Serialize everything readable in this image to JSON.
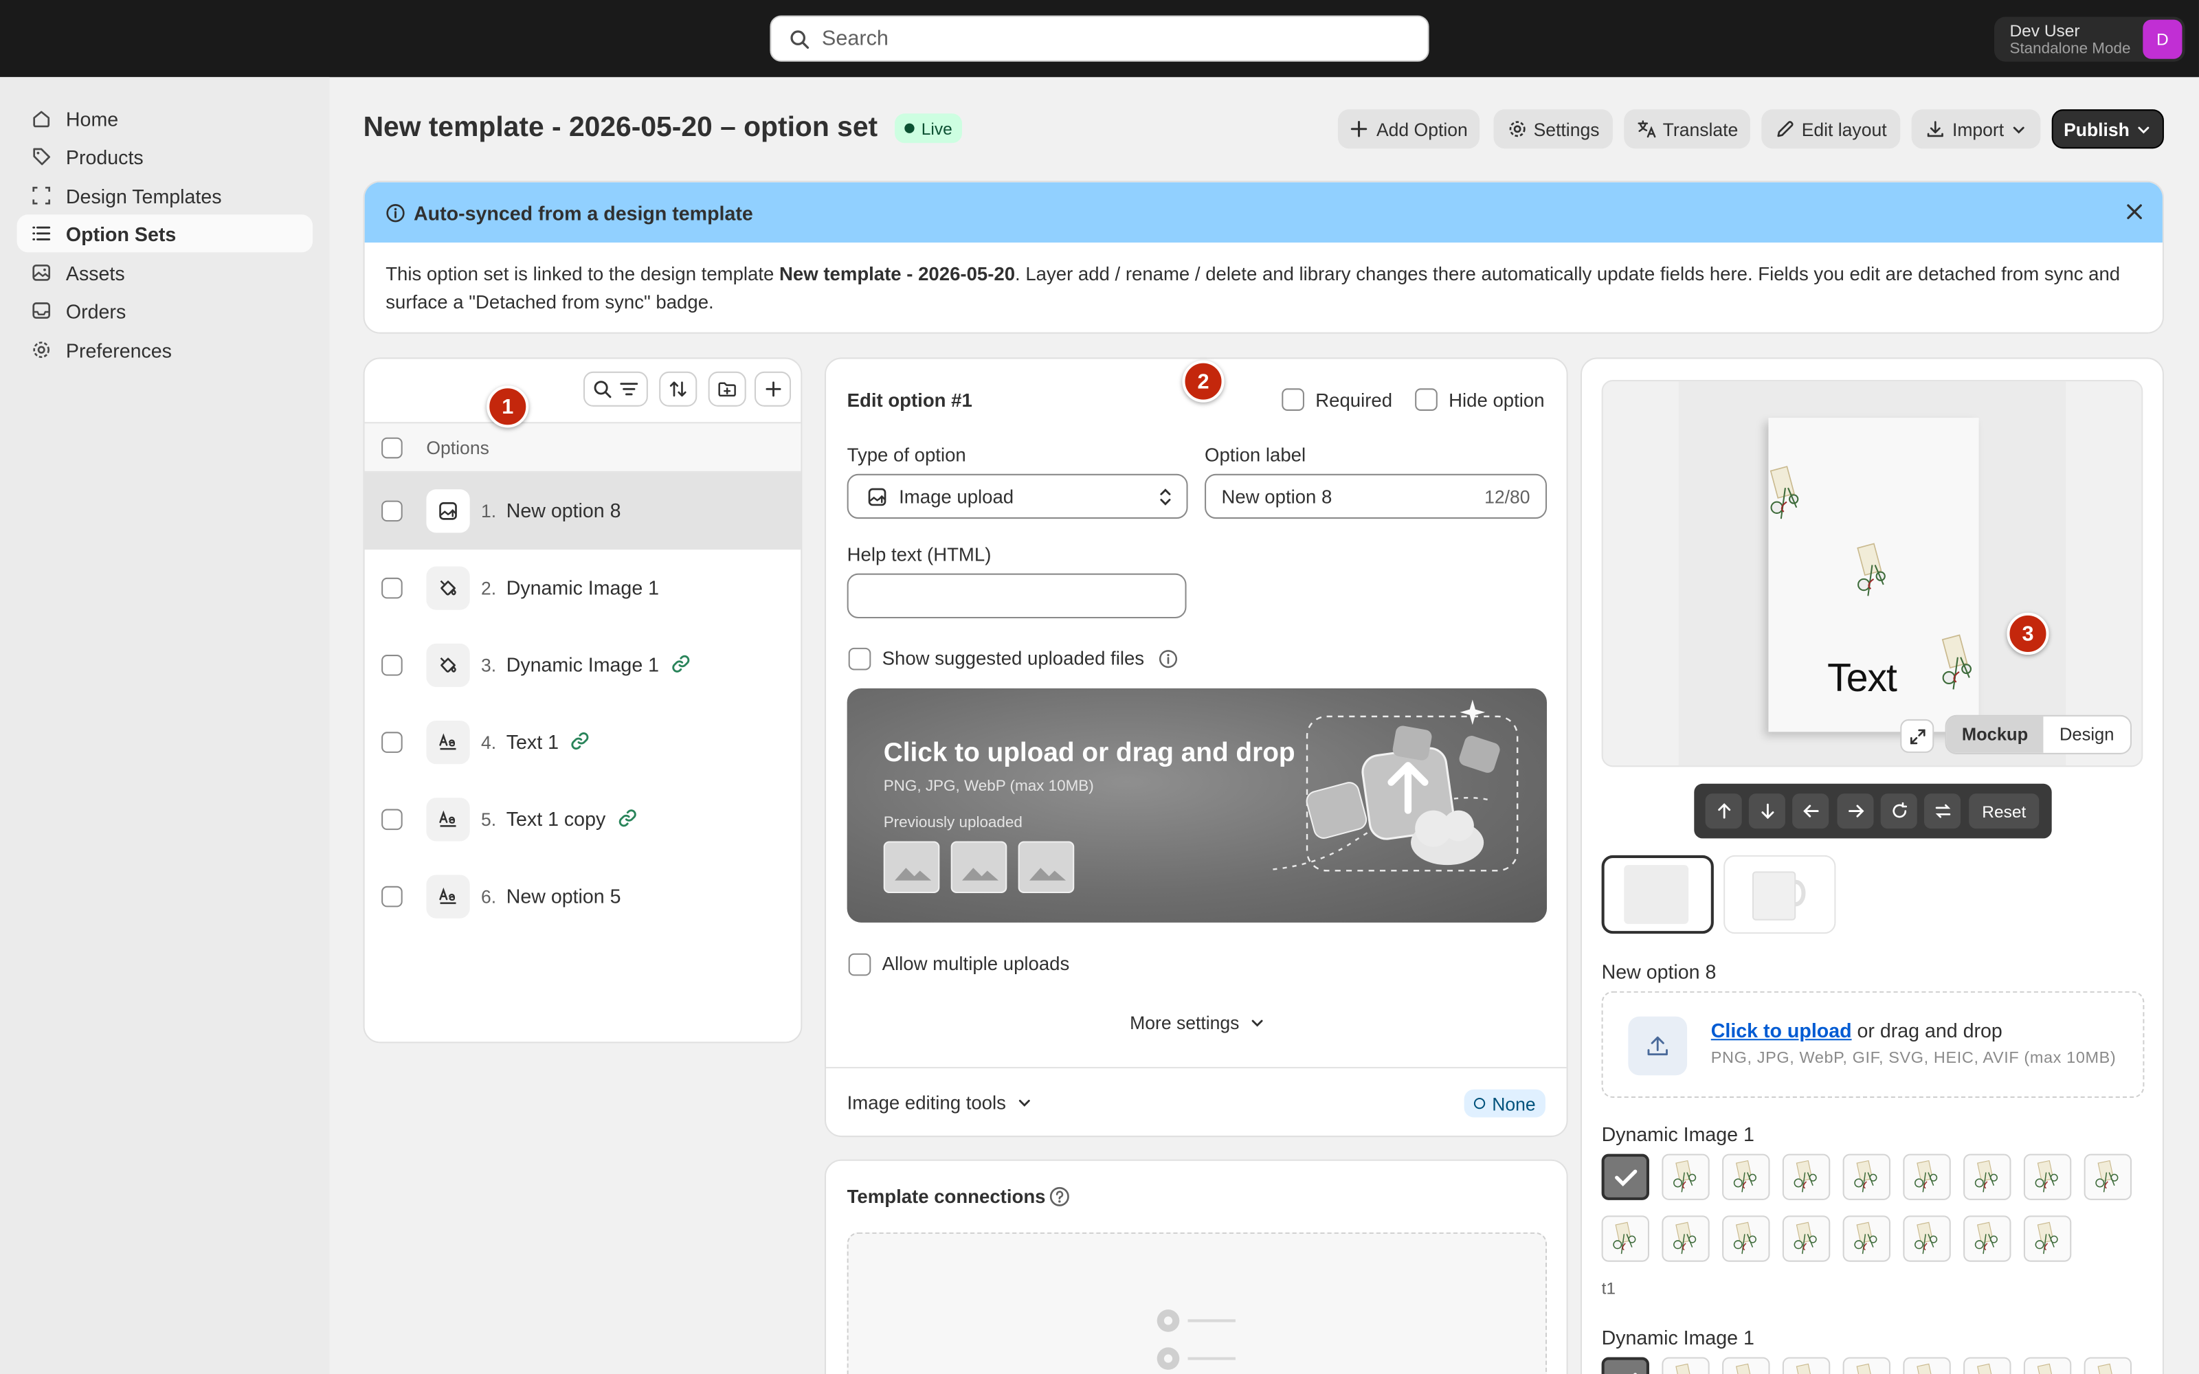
{
  "topbar": {
    "search_placeholder": "Search",
    "user_name": "Dev User",
    "user_mode": "Standalone Mode",
    "avatar_initial": "D"
  },
  "sidebar": {
    "items": [
      {
        "label": "Home",
        "icon": "home-icon"
      },
      {
        "label": "Products",
        "icon": "tag-icon"
      },
      {
        "label": "Design Templates",
        "icon": "template-icon"
      },
      {
        "label": "Option Sets",
        "icon": "list-icon",
        "active": true
      },
      {
        "label": "Assets",
        "icon": "image-icon"
      },
      {
        "label": "Orders",
        "icon": "inbox-icon"
      },
      {
        "label": "Preferences",
        "icon": "gear-icon"
      }
    ]
  },
  "header": {
    "title": "New template - 2026-05-20 – option set",
    "status": "Live",
    "buttons": {
      "add_option": "Add Option",
      "settings": "Settings",
      "translate": "Translate",
      "edit_layout": "Edit layout",
      "import": "Import",
      "publish": "Publish"
    }
  },
  "banner": {
    "title": "Auto-synced from a design template",
    "body_pre": "This option set is linked to the design template ",
    "body_bold": "New template - 2026-05-20",
    "body_post": ". Layer add / rename / delete and library changes there automatically update fields here. Fields you edit are detached from sync and surface a \"Detached from sync\" badge."
  },
  "options_list": {
    "header": "Options",
    "items": [
      {
        "num": "1.",
        "name": "New option 8",
        "icon": "image-upload-icon",
        "linked": false,
        "selected": true
      },
      {
        "num": "2.",
        "name": "Dynamic Image 1",
        "icon": "fill-icon",
        "linked": false
      },
      {
        "num": "3.",
        "name": "Dynamic Image 1",
        "icon": "fill-icon",
        "linked": true
      },
      {
        "num": "4.",
        "name": "Text 1",
        "icon": "text-icon",
        "linked": true
      },
      {
        "num": "5.",
        "name": "Text 1 copy",
        "icon": "text-icon",
        "linked": true
      },
      {
        "num": "6.",
        "name": "New option 5",
        "icon": "text-icon",
        "linked": false
      }
    ]
  },
  "markers": [
    "1",
    "2",
    "3"
  ],
  "edit": {
    "title": "Edit option #1",
    "required_label": "Required",
    "hide_label": "Hide option",
    "type_label": "Type of option",
    "type_value": "Image upload",
    "option_label_label": "Option label",
    "option_label_value": "New option 8",
    "option_label_count": "12/80",
    "help_label": "Help text (HTML)",
    "help_value": "",
    "show_suggested": "Show suggested uploaded files",
    "upload_title": "Click to upload or drag and drop",
    "upload_sub": "PNG, JPG, WebP (max 10MB)",
    "previously_uploaded": "Previously uploaded",
    "allow_multiple": "Allow multiple uploads",
    "more_settings": "More settings",
    "image_tools": "Image editing tools",
    "image_tools_badge": "None"
  },
  "connections": {
    "title": "Template connections"
  },
  "preview": {
    "canvas_text": "Text",
    "view_modes": [
      "Mockup",
      "Design"
    ],
    "active_view": "Mockup",
    "reset": "Reset",
    "upload_section_title": "New option 8",
    "upload_link": "Click to upload",
    "upload_rest": " or drag and drop",
    "upload_formats": "PNG, JPG, WebP, GIF, SVG, HEIC, AVIF (max 10MB)",
    "dyn1_title": "Dynamic Image 1",
    "swatch_caption": "t1",
    "dyn2_title": "Dynamic Image 1"
  },
  "colors": {
    "topbar": "#1a1a1a",
    "banner": "#91d0ff",
    "live_badge": "#cdfee1",
    "marker": "#c4270c",
    "avatar": "#c12fd4",
    "link": "#005bd3"
  }
}
